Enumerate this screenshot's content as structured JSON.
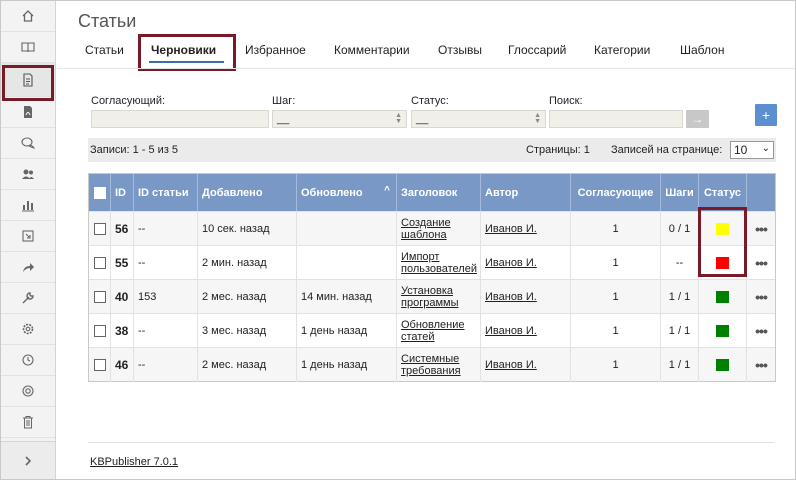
{
  "page": {
    "title": "Статьи"
  },
  "tabs": [
    {
      "label": "Статьи"
    },
    {
      "label": "Черновики"
    },
    {
      "label": "Избранное"
    },
    {
      "label": "Комментарии"
    },
    {
      "label": "Отзывы"
    },
    {
      "label": "Глоссарий"
    },
    {
      "label": "Категории"
    },
    {
      "label": "Шаблон"
    }
  ],
  "sidebar": {
    "items": [
      {
        "icon": "home-icon"
      },
      {
        "icon": "book-icon"
      },
      {
        "icon": "document-icon",
        "active": true
      },
      {
        "icon": "pdf-icon"
      },
      {
        "icon": "chat-icon"
      },
      {
        "icon": "users-icon"
      },
      {
        "icon": "chart-icon"
      },
      {
        "icon": "import-icon"
      },
      {
        "icon": "share-icon"
      },
      {
        "icon": "wrench-icon"
      },
      {
        "icon": "gear-icon"
      },
      {
        "icon": "history-icon"
      },
      {
        "icon": "help-icon"
      },
      {
        "icon": "trash-icon"
      }
    ],
    "expand_icon": "chevron-right-icon"
  },
  "filters": {
    "approver_label": "Согласующий:",
    "approver_value": "",
    "step_label": "Шаг:",
    "step_value": "__",
    "status_label": "Статус:",
    "status_value": "__",
    "search_label": "Поиск:",
    "search_value": "",
    "go_label": "→",
    "add_label": "+"
  },
  "infobar": {
    "records": "Записи: 1 - 5 из 5",
    "pages": "Страницы: 1",
    "per_page_label": "Записей на странице:",
    "per_page_value": "10"
  },
  "table": {
    "headers": {
      "id": "ID",
      "article_id": "ID статьи",
      "added": "Добавлено",
      "updated": "Обновлено",
      "sort_icon": "^",
      "title": "Заголовок",
      "author": "Автор",
      "approvers": "Согласующие",
      "steps": "Шаги",
      "status": "Статус"
    },
    "rows": [
      {
        "id": "56",
        "article_id": "--",
        "added": "10 сек. назад",
        "updated": "",
        "title_1": "Создание",
        "title_2": "шаблона",
        "author": "Иванов И.",
        "approvers": "1",
        "steps": "0 / 1",
        "status_color": "#ffff00",
        "more": "•••"
      },
      {
        "id": "55",
        "article_id": "--",
        "added": "2 мин. назад",
        "updated": "",
        "title_1": "Импорт",
        "title_2": "пользователей",
        "author": "Иванов И.",
        "approvers": "1",
        "steps": "--",
        "status_color": "#ff0000",
        "more": "•••"
      },
      {
        "id": "40",
        "article_id": "153",
        "added": "2 мес. назад",
        "updated": "14 мин. назад",
        "title_1": "Установка",
        "title_2": "программы",
        "author": "Иванов И.",
        "approvers": "1",
        "steps": "1 / 1",
        "status_color": "#008000",
        "more": "•••"
      },
      {
        "id": "38",
        "article_id": "--",
        "added": "3 мес. назад",
        "updated": "1 день назад",
        "title_1": "Обновление",
        "title_2": "статей",
        "author": "Иванов И.",
        "approvers": "1",
        "steps": "1 / 1",
        "status_color": "#008000",
        "more": "•••"
      },
      {
        "id": "46",
        "article_id": "--",
        "added": "2 мес. назад",
        "updated": "1 день назад",
        "title_1": "Системные",
        "title_2": "требования",
        "author": "Иванов И.",
        "approvers": "1",
        "steps": "1 / 1",
        "status_color": "#008000",
        "more": "•••"
      }
    ]
  },
  "footer": {
    "version": "KBPublisher 7.0.1"
  }
}
